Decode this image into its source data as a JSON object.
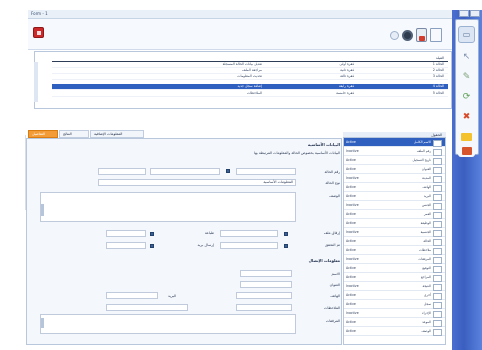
{
  "window": {
    "title": "Form - 1"
  },
  "toolbar": {
    "icons": [
      "document-icon",
      "delete-icon",
      "settings-icon",
      "help-icon"
    ]
  },
  "side_rail": {
    "buttons": [
      "tooltip-icon",
      "arrow-icon",
      "edit-icon",
      "refresh-icon",
      "delete-icon",
      "folder-icon",
      "export-icon"
    ]
  },
  "upper_list": {
    "header": "الفيلد",
    "rows": [
      {
        "c1": "الحالة 1",
        "c2": "فقرة أولى",
        "c3": "تعديل بيانات الحالة المسجلة"
      },
      {
        "c1": "الحالة 2",
        "c2": "فقرة ثانية",
        "c3": "مراجعة الملف"
      },
      {
        "c1": "الحالة 3",
        "c2": "فقرة ثالثة",
        "c3": "تحديث المعلومات"
      },
      {
        "c1": "الحالة 4",
        "c2": "فقرة رابعة",
        "c3": "إضافة سجل جديد",
        "selected": true
      },
      {
        "c1": "الحالة 5",
        "c2": "فقرة خامسة",
        "c3": "الملاحظات"
      }
    ]
  },
  "tabs": [
    {
      "label": "التفاصيل",
      "active": true
    },
    {
      "label": "النتائج"
    },
    {
      "label": "المعلومات الإضافية"
    }
  ],
  "form": {
    "section1_title": "البيانات الأساسية",
    "section1_hint": "البيانات الأساسية بخصوص الحالة والمعلومات المرتبطة بها",
    "f1_label": "رقم الحالة",
    "f1_value": "",
    "f2_label": "نوع الحالة",
    "f2_value": "المعلومات الأساسية",
    "f3_label": "الوصف",
    "f4_label": "الجهة",
    "f5_label": "التاريخ",
    "chk1_label": "إرفاق ملف",
    "chk2_label": "طباعة",
    "chk3_label": "تم التحقق",
    "chk4_label": "إرسال بريد",
    "section2_title": "معلومات الإتصال",
    "f6_label": "الاسم",
    "f7_label": "العنوان",
    "f8_label": "الهاتف",
    "f9_label": "البريد",
    "f10_label": "الملاحظات",
    "f11_label": "المرفقات"
  },
  "right_list": {
    "header": "الحقول",
    "rows": [
      {
        "name": "الاسم الكامل",
        "status": "Active",
        "selected": true
      },
      {
        "name": "رقم الملف",
        "status": "Inactive"
      },
      {
        "name": "تاريخ التسجيل",
        "status": "Active"
      },
      {
        "name": "العنوان",
        "status": "Active"
      },
      {
        "name": "المدينة",
        "status": "Inactive"
      },
      {
        "name": "الهاتف",
        "status": "Active"
      },
      {
        "name": "البريد",
        "status": "Active"
      },
      {
        "name": "الجنس",
        "status": "Inactive"
      },
      {
        "name": "العمر",
        "status": "Active"
      },
      {
        "name": "الوظيفة",
        "status": "Active"
      },
      {
        "name": "الجنسية",
        "status": "Inactive"
      },
      {
        "name": "الحالة",
        "status": "Active"
      },
      {
        "name": "ملاحظات",
        "status": "Active"
      },
      {
        "name": "المرفقات",
        "status": "Inactive"
      },
      {
        "name": "التوقيع",
        "status": "Active"
      },
      {
        "name": "المراجع",
        "status": "Active"
      },
      {
        "name": "النتيجة",
        "status": "Inactive"
      },
      {
        "name": "أخرى",
        "status": "Active"
      },
      {
        "name": "سجل",
        "status": "Active"
      },
      {
        "name": "الإجراء",
        "status": "Inactive"
      },
      {
        "name": "الموعد",
        "status": "Active"
      },
      {
        "name": "الوصف",
        "status": "Active"
      }
    ]
  },
  "colors": {
    "rail": "#3b5fc0",
    "selection": "#2f60c0",
    "active_tab": "#f39b36",
    "logo": "#cc2a2a"
  }
}
